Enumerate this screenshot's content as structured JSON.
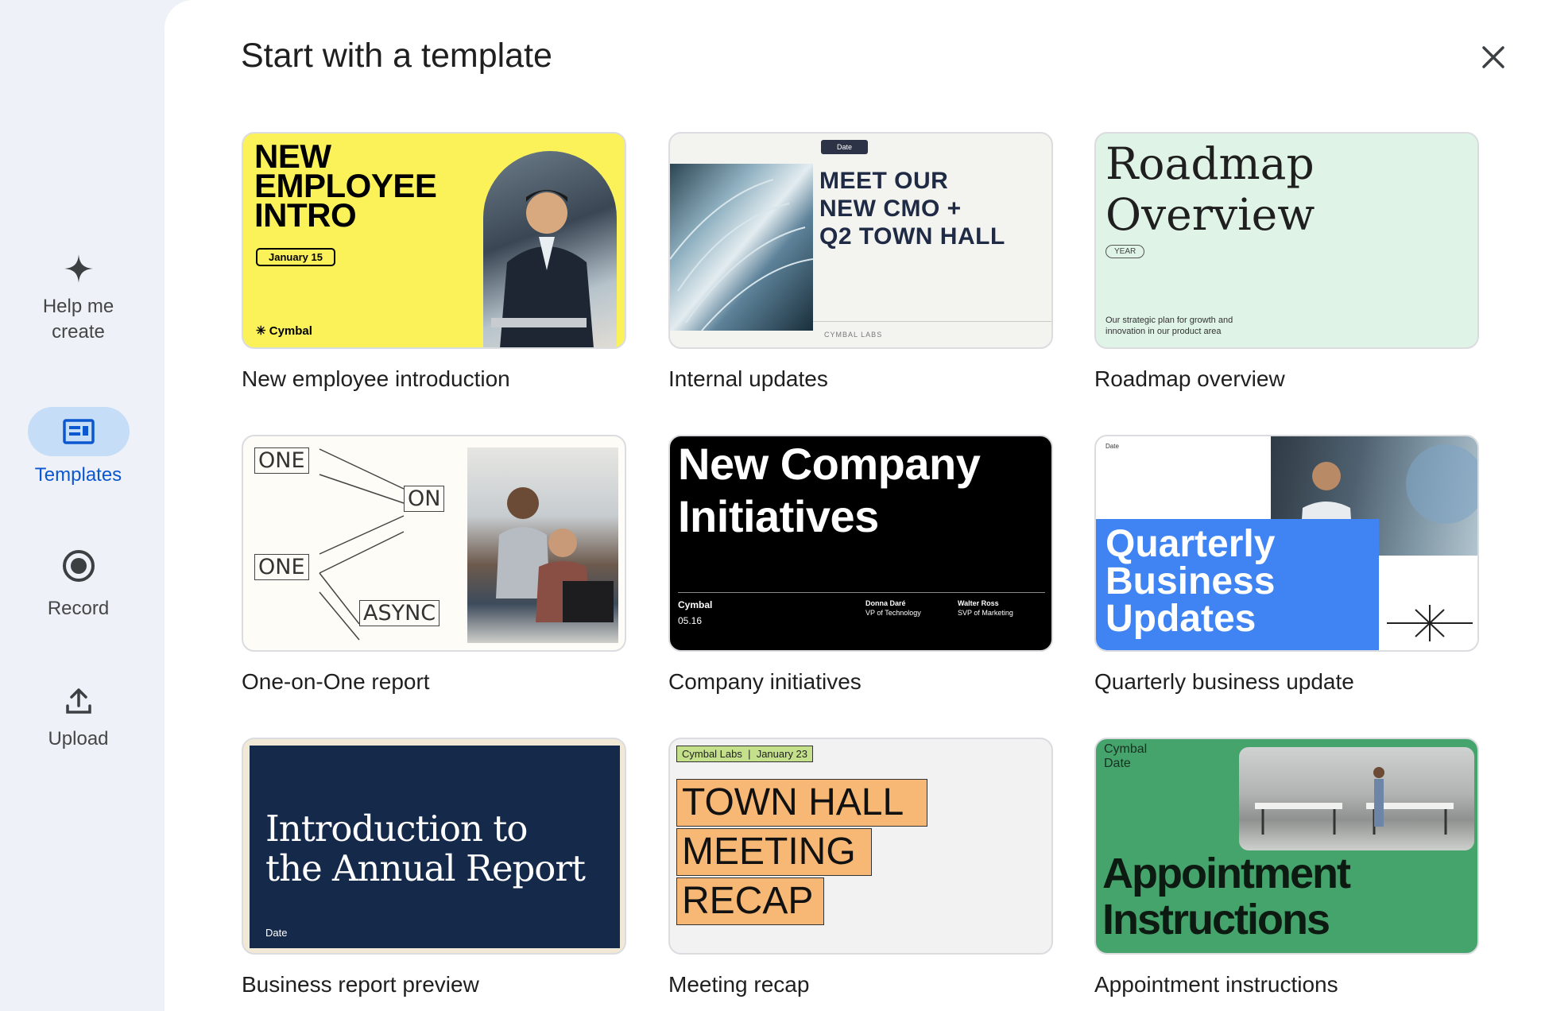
{
  "sidebar": {
    "items": [
      {
        "label": "Help me create",
        "icon": "sparkle-icon"
      },
      {
        "label": "Templates",
        "icon": "templates-icon",
        "active": true
      },
      {
        "label": "Record",
        "icon": "record-icon"
      },
      {
        "label": "Upload",
        "icon": "upload-icon"
      }
    ]
  },
  "dialog": {
    "title": "Start with a template",
    "close_icon": "close-icon"
  },
  "templates": [
    {
      "caption": "New employee introduction",
      "heading": "NEW\nEMPLOYEE\nINTRO",
      "date": "January 15",
      "brand": "Cymbal"
    },
    {
      "caption": "Internal updates",
      "badge": "Date",
      "heading": "MEET OUR\nNEW CMO +\nQ2 TOWN HALL",
      "footer": "CYMBAL LABS"
    },
    {
      "caption": "Roadmap overview",
      "heading": "Roadmap\nOverview",
      "year": "YEAR",
      "desc": "Our strategic plan for growth and innovation in our product area"
    },
    {
      "caption": "One-on-One report",
      "boxes": [
        "ONE",
        "ON",
        "ONE",
        "ASYNC"
      ]
    },
    {
      "caption": "Company initiatives",
      "heading": "New Company\nInitiatives",
      "brand": "Cymbal",
      "date": "05.16",
      "person1_name": "Donna Daré",
      "person1_role": "VP of Technology",
      "person2_name": "Walter Ross",
      "person2_role": "SVP of Marketing"
    },
    {
      "caption": "Quarterly business update",
      "date": "Date",
      "heading": "Quarterly\nBusiness\nUpdates"
    },
    {
      "caption": "Business report preview",
      "heading": "Introduction to\nthe Annual Report",
      "date": "Date"
    },
    {
      "caption": "Meeting recap",
      "tag": "Cymbal Labs  |  January 23",
      "lines": [
        "TOWN HALL",
        "MEETING",
        "RECAP"
      ]
    },
    {
      "caption": "Appointment instructions",
      "company": "Cymbal\nDate",
      "heading": "Appointment\nInstructions"
    }
  ],
  "colors": {
    "rail_bg": "#eef1f7",
    "active_pill": "#c6ddf8",
    "active_text": "#0b57d0",
    "yellow": "#fbf25a",
    "mint": "#dff3e6",
    "blue": "#3f84f2",
    "navy": "#15294a",
    "orange": "#f6b874",
    "green": "#45a46c"
  }
}
